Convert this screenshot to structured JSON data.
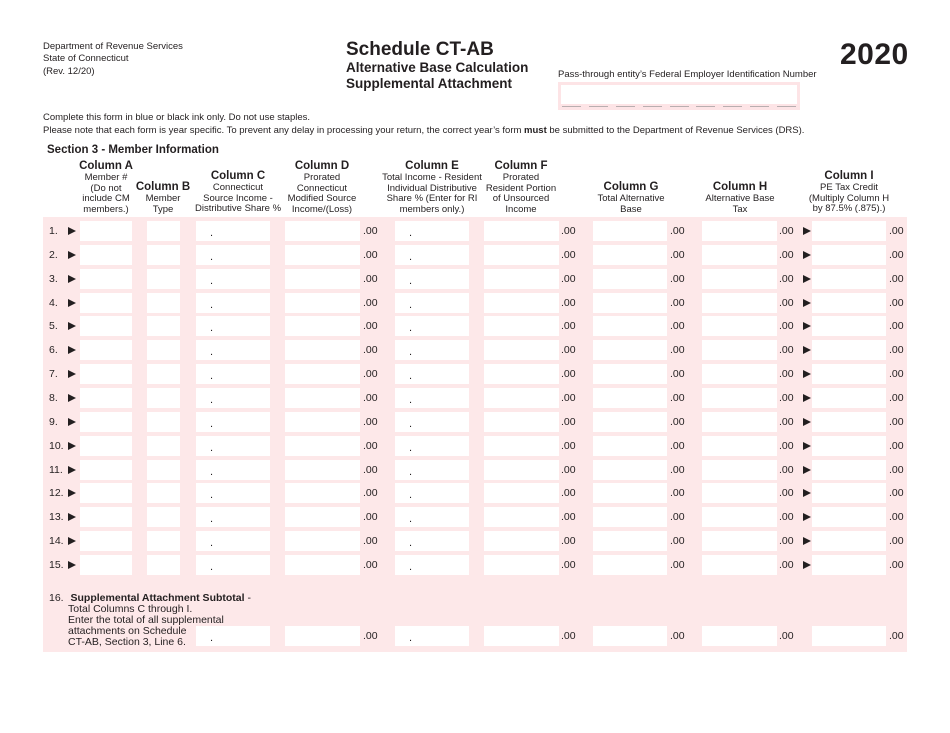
{
  "header": {
    "agency_lines": [
      "Department of Revenue Services",
      "State of Connecticut",
      "(Rev. 12/20)"
    ],
    "title": "Schedule CT-AB",
    "subtitle_1": "Alternative Base Calculation",
    "subtitle_2": "Supplemental Attachment",
    "year": "2020",
    "fein_label": "Pass-through entity’s Federal Employer Identification Number",
    "fein_value": ""
  },
  "instructions": {
    "line1": "Complete this form in blue or black ink only. Do not use staples.",
    "line2_pre": "Please note that each form is year specific. To prevent any delay in processing your return, the correct year’s form ",
    "line2_bold": "must",
    "line2_post": " be submitted to the Department of Revenue Services (DRS)."
  },
  "section_title": "Section 3 - Member Information",
  "columns": [
    {
      "key": "A",
      "title": "Column A",
      "desc": [
        "Member #",
        "(Do not",
        "include CM",
        "members.)"
      ]
    },
    {
      "key": "B",
      "title": "Column B",
      "desc": [
        "Member",
        "Type"
      ]
    },
    {
      "key": "C",
      "title": "Column C",
      "desc": [
        "Connecticut",
        "Source Income -",
        "Distributive Share %"
      ]
    },
    {
      "key": "D",
      "title": "Column D",
      "desc": [
        "Prorated",
        "Connecticut",
        "Modified Source",
        "Income/(Loss)"
      ]
    },
    {
      "key": "E",
      "title": "Column E",
      "desc": [
        "Total Income - Resident",
        "Individual Distributive",
        "Share % (Enter for RI",
        "members only.)"
      ]
    },
    {
      "key": "F",
      "title": "Column F",
      "desc": [
        "Prorated",
        "Resident Portion",
        "of Unsourced",
        "Income"
      ]
    },
    {
      "key": "G",
      "title": "Column G",
      "desc": [
        "Total Alternative",
        "Base"
      ]
    },
    {
      "key": "H",
      "title": "Column H",
      "desc": [
        "Alternative Base",
        "Tax"
      ]
    },
    {
      "key": "I",
      "title": "Column I",
      "desc": [
        "PE Tax Credit",
        "(Multiply Column H",
        "by 87.5% (.875).)"
      ]
    }
  ],
  "decimal_suffix": ".00",
  "decimal_point": ".",
  "rows": [
    {
      "label": "1."
    },
    {
      "label": "2."
    },
    {
      "label": "3."
    },
    {
      "label": "4."
    },
    {
      "label": "5."
    },
    {
      "label": "6."
    },
    {
      "label": "7."
    },
    {
      "label": "8."
    },
    {
      "label": "9."
    },
    {
      "label": "10."
    },
    {
      "label": "11."
    },
    {
      "label": "12."
    },
    {
      "label": "13."
    },
    {
      "label": "14."
    },
    {
      "label": "15."
    }
  ],
  "subtotal": {
    "number": "16.",
    "title": "Supplemental Attachment Subtotal",
    "title_suffix": " -",
    "lines": [
      "Total Columns C through I.",
      "Enter the total of all supplemental",
      "attachments on Schedule",
      "CT-AB, Section 3, Line 6."
    ]
  },
  "colors": {
    "field_bg": "#fde8e9",
    "text": "#231f20"
  }
}
